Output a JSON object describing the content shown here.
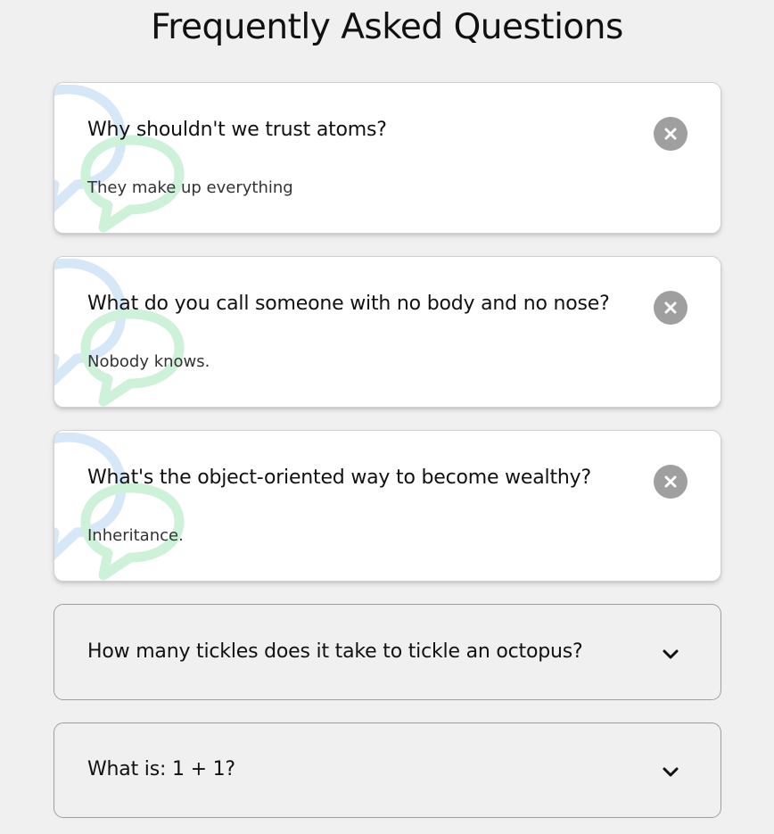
{
  "page": {
    "title": "Frequently Asked Questions"
  },
  "faqs": [
    {
      "question": "Why shouldn't we trust atoms?",
      "answer": "They make up everything",
      "state": "open",
      "toggle_icon": "close-icon"
    },
    {
      "question": "What do you call someone with no body and no nose?",
      "answer": "Nobody knows.",
      "state": "open",
      "toggle_icon": "close-icon"
    },
    {
      "question": "What's the object-oriented way to become wealthy?",
      "answer": "Inheritance.",
      "state": "open",
      "toggle_icon": "close-icon"
    },
    {
      "question": "How many tickles does it take to tickle an octopus?",
      "state": "closed",
      "toggle_icon": "chevron-down-icon"
    },
    {
      "question": "What is: 1 + 1?",
      "state": "closed",
      "toggle_icon": "chevron-down-icon"
    }
  ],
  "colors": {
    "background": "#f0f0f0",
    "card_active": "#ffffff",
    "close_button": "#9f9f9f",
    "bubble_blue": "#d6e7f7",
    "bubble_green": "#cdf2d9",
    "text": "#111111"
  },
  "icons": {
    "decoration": "speech-bubbles-icon"
  }
}
